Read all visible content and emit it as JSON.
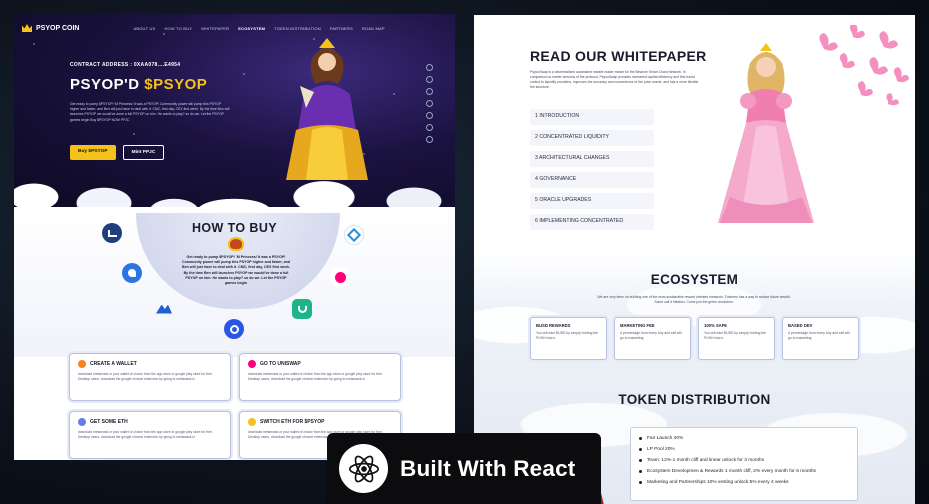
{
  "left": {
    "logo": "PSYOP COIN",
    "nav": [
      "ABOUT US",
      "HOW TO BUY",
      "WHITEPAPER",
      "ECOSYSTEM",
      "TOKEN DISTRIBUTION",
      "PARTNERS",
      "ROAD MAP"
    ],
    "contract": "CONTRACT ADDRESS : 0XAA078....E4954",
    "title_main": "PSYOP'D ",
    "title_accent": "$PSYOP",
    "description": "Get ready to pump $PSYOP! 'M Princess! It was a PSYOP! Community power will pump this PSYOP higher and faster, and Ben will just have to deal with it. CMC, first day, CEX first week. By the time Ben will launches PSYOP we would've done a full PSYOP on him. He wants to play? so do we. Let the PSYOP games begin Buy $PSYOP NOW PPJC",
    "buy_button": "Buy $PSYOP",
    "mint_button": "Mint PPJC",
    "howto_title": "HOW TO BUY",
    "howto_desc": "Get ready to pump $PSYOP! 'M Princess! It was a PSYOP! Community power will pump this PSYOP higher and faster, and Ben will just have to deal with it. CMC, first day, CEX first week. By the time Ben will launches PSYOP we would've done a full PSYOP on him. He wants to play? so do we. Let the PSYOP games begin",
    "cards": [
      {
        "title": "CREATE A WALLET",
        "text": "download metamask or your wallet of choice from the app store or google play store for free. Desktop users, download the google chrome extension by going to metamask.io"
      },
      {
        "title": "GO TO UNISWAP",
        "text": "download metamask or your wallet of choice from the app store or google play store for free. Desktop users, download the google chrome extension by going to metamask.io"
      },
      {
        "title": "GET SOME ETH",
        "text": "download metamask or your wallet of choice from the app store or google play store for free. Desktop users, download the google chrome extension by going to metamask.io"
      },
      {
        "title": "SWITCH ETH FOR $PSYOP",
        "text": "download metamask or your wallet of choice from the app store or google play store for free. Desktop users, download the google chrome extension by going to metamask.io"
      }
    ]
  },
  "right": {
    "wp_title": "READ OUR WHITEPAPER",
    "wp_desc": "PsycoSwap is a decentralized automated market maker meant for the Binance Smart Chain Network. In comparison to earlier versions of the protocol, PsycoSwap provides increased capital efficiency and fine-tuned control to liquidity providers, improves the accuracy and convenience of the price oracle, and has a more flexible fee structure.",
    "wp_items": [
      "1 INTRODUCTION",
      "2 CONCENTRATED LIQUIDITY",
      "3 ARCHITECTURAL CHANGES",
      "4 GOVERNANCE",
      "5 ORACLE UPGRADES",
      "6 IMPLEMENTING CONCENTRATED"
    ],
    "eco_title": "ECOSYSTEM",
    "eco_desc": "We are very keen on building one of the most sustainable reward oriented metacoin, Fusheen has a way to reduce future wealth. Some call it inflation. Come join the green revolution.",
    "eco_cards": [
      {
        "title": "BUSD REWARDS",
        "text": "You will earn BUSD by simply holding the PUSH token."
      },
      {
        "title": "MARKETING FEE",
        "text": "A percentage from every buy and sell will go to marketing."
      },
      {
        "title": "100% SAFE",
        "text": "You will earn BUSD by simply holding the PUSH token."
      },
      {
        "title": "BASED DEV",
        "text": "A percentage from every buy and sell will go to marketing."
      }
    ],
    "td_title": "TOKEN DISTRIBUTION",
    "td_items": [
      "Fair Launch 40%",
      "LP Pool 20%",
      "Team: 12%-1 month cliff and linear unlock for 3 months",
      "Ecosystem Developmen & Rewards 1 month cliff, 2% every month for 6 months",
      "Marketing and Partnerships 10% vesting unlock:5% every 4 weeks"
    ]
  },
  "badge": {
    "text": "Built With React"
  },
  "colors": {
    "accent": "#f4c21b",
    "hero_bg": "#1b1240",
    "text_dark": "#1b1b2b"
  }
}
